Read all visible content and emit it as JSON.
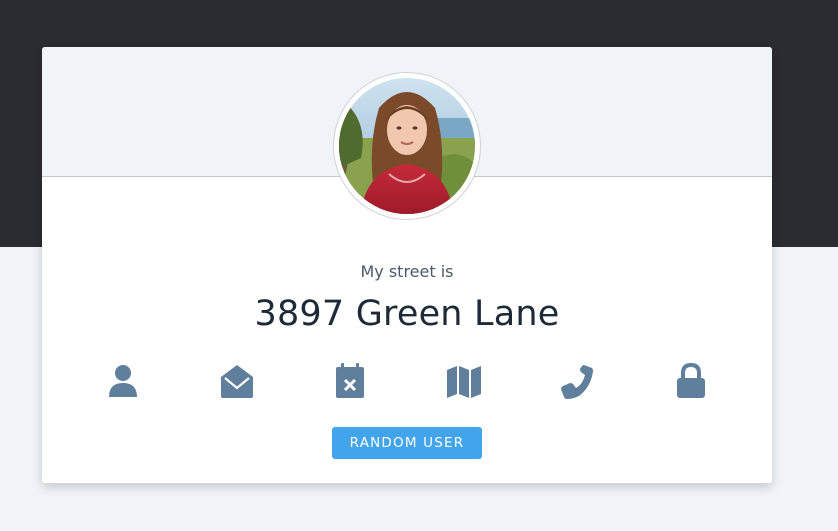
{
  "colors": {
    "top_band": "#2b2c31",
    "page_background": "#f0f4f8",
    "icon_color": "#5f7f9c",
    "button_color": "#42a4ea"
  },
  "profile": {
    "label": "My street is",
    "value": "3897 Green Lane",
    "avatar": "profile-photo"
  },
  "icons": [
    "user-icon",
    "envelope-open-icon",
    "calendar-times-icon",
    "map-icon",
    "phone-icon",
    "lock-icon"
  ],
  "actions": {
    "random_label": "RANDOM USER"
  }
}
